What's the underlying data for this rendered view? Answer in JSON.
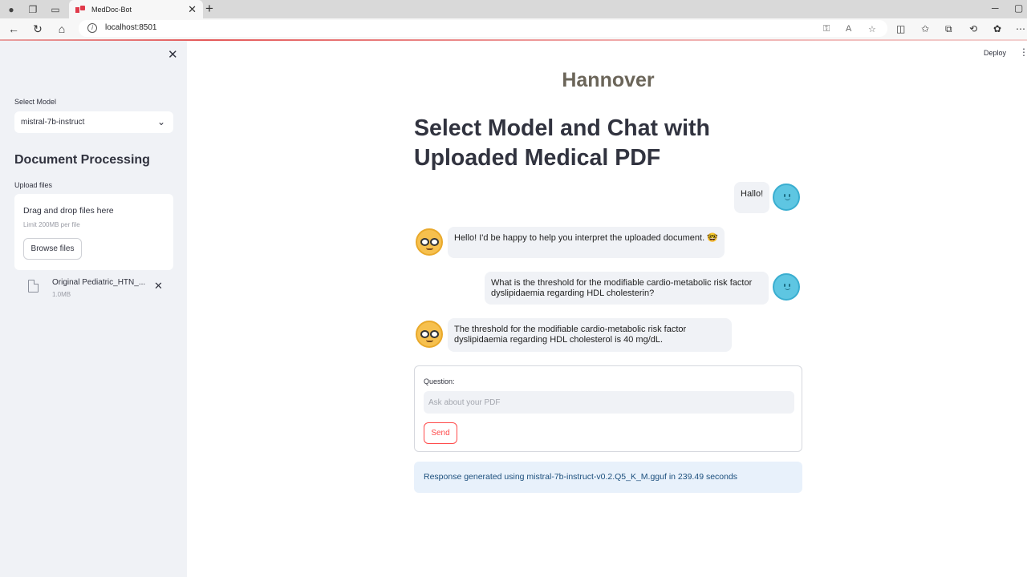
{
  "browser": {
    "tab_title": "MedDoc-Bot",
    "url": "localhost:8501"
  },
  "sidebar": {
    "select_model_label": "Select Model",
    "selected_model": "mistral-7b-instruct",
    "section_heading": "Document Processing",
    "upload_label": "Upload files",
    "dropzone_title": "Drag and drop files here",
    "dropzone_limit": "Limit 200MB per file",
    "browse_button": "Browse files",
    "uploaded_file": {
      "name": "Original Pediatric_HTN_...",
      "size": "1.0MB"
    }
  },
  "header": {
    "deploy_label": "Deploy"
  },
  "main": {
    "brand": "Hannover",
    "title": "Select Model and Chat with Uploaded Medical PDF",
    "messages": [
      {
        "role": "user",
        "text": "Hallo!"
      },
      {
        "role": "assistant",
        "text": "Hello! I'd be happy to help you interpret the uploaded document. 🤓"
      },
      {
        "role": "user",
        "text": "What is the threshold for the modifiable cardio-metabolic risk factor dyslipidaemia regarding HDL cholesterin?"
      },
      {
        "role": "assistant",
        "text": "The threshold for the modifiable cardio-metabolic risk factor dyslipidaemia regarding HDL cholesterol is 40 mg/dL."
      }
    ],
    "form": {
      "question_label": "Question:",
      "placeholder": "Ask about your PDF",
      "send_label": "Send"
    },
    "info": "Response generated using mistral-7b-instruct-v0.2.Q5_K_M.gguf in 239.49 seconds"
  },
  "colors": {
    "primary": "#ff4b4b",
    "sidebar_bg": "#f0f2f6",
    "info_bg": "#e8f1fb"
  }
}
